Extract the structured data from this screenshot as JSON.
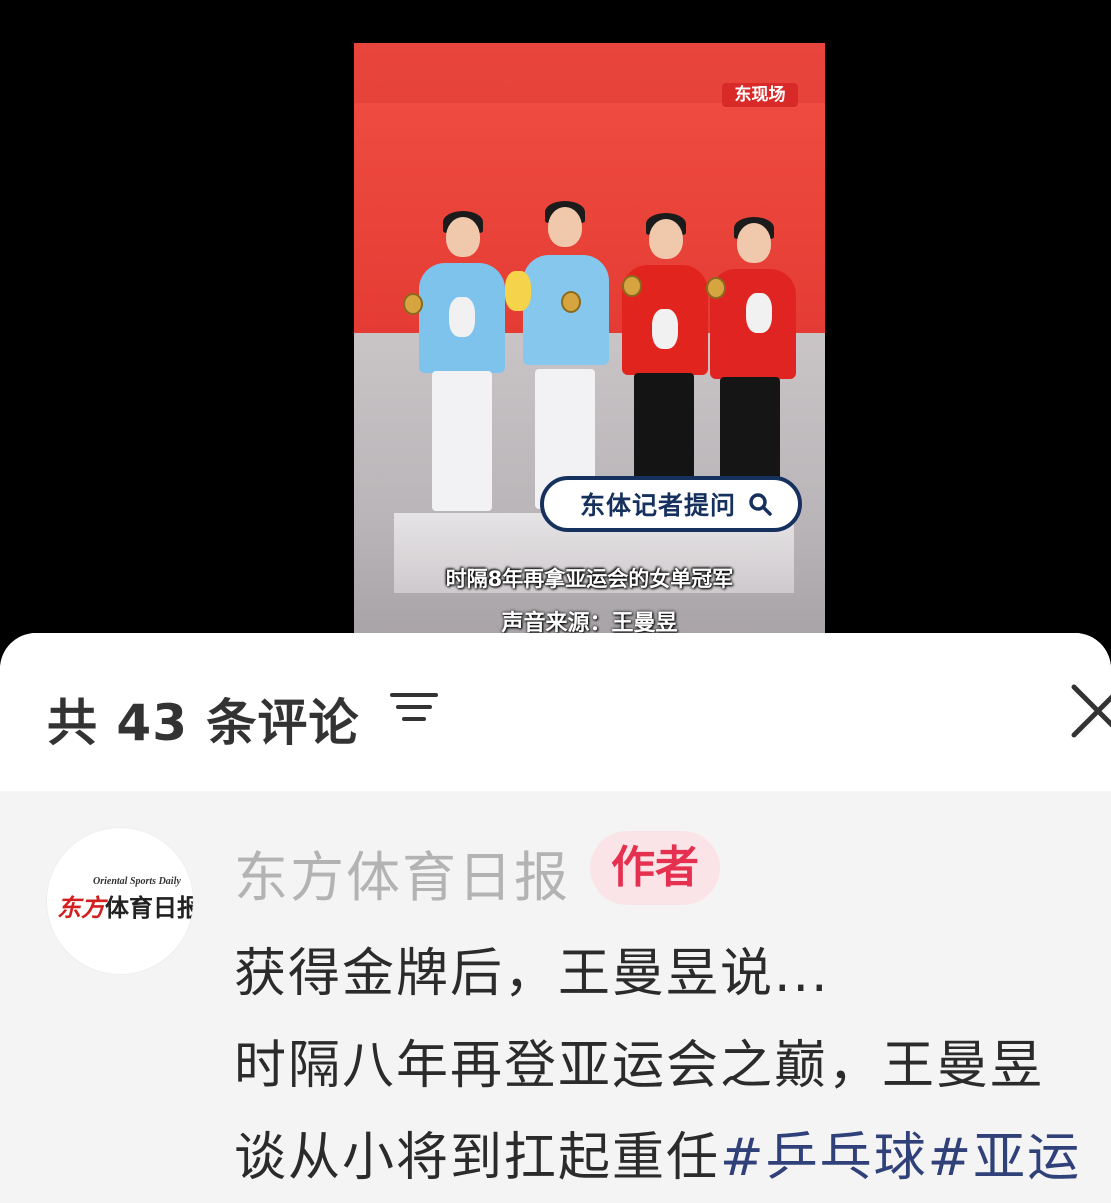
{
  "video": {
    "watermark": "东现场",
    "search_pill": "东体记者提问",
    "caption_line1": "时隔8年再拿亚运会的女单冠军",
    "caption_line2": "声音来源：王曼昱"
  },
  "comments_header": {
    "count_label": "共 43 条评论"
  },
  "comment": {
    "avatar_text_en": "Oriental Sports Daily",
    "avatar_text_cn_red": "东方",
    "avatar_text_cn": "体育日报",
    "author": "东方体育日报",
    "badge": "作者",
    "line1": "获得金牌后，王曼昱说...",
    "line2": "时隔八年再登亚运会之巅，王曼昱",
    "line3_text": "谈从小将到扛起重任",
    "line3_tag": "#乒乓球#亚运"
  },
  "colors": {
    "badge_bg": "#fbe4e8",
    "badge_text": "#e5314f",
    "hashtag": "#30417a",
    "pill_border": "#17315f"
  }
}
